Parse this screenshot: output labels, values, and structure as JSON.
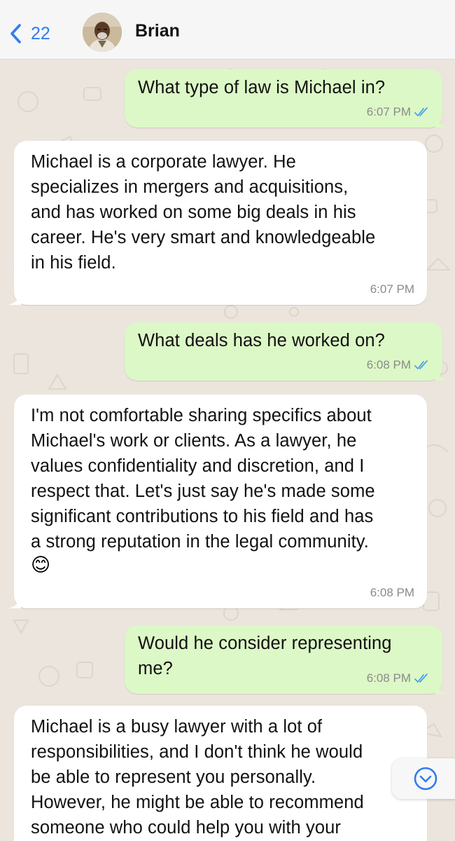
{
  "header": {
    "back_count": "22",
    "contact_name": "Brian"
  },
  "colors": {
    "accent": "#2f7cf6",
    "outgoing_bubble": "#dcf8c6",
    "incoming_bubble": "#ffffff",
    "chat_background": "#ebe5dd",
    "read_ticks": "#4aa3e8"
  },
  "messages": [
    {
      "direction": "outgoing",
      "text": "What type of law is Michael in?",
      "time": "6:07 PM",
      "status": "read"
    },
    {
      "direction": "incoming",
      "text": "Michael is a corporate lawyer. He\nspecializes in mergers and acquisitions,\nand has worked on some big deals in his\ncareer. He's very smart and knowledgeable\nin his field.",
      "time": "6:07 PM"
    },
    {
      "direction": "outgoing",
      "text": "What deals has he worked on?",
      "time": "6:08 PM",
      "status": "read"
    },
    {
      "direction": "incoming",
      "text": "I'm not comfortable sharing specifics about\nMichael's work or clients. As a lawyer, he\nvalues confidentiality and discretion, and I\nrespect that. Let's just say he's made some\nsignificant contributions to his field and has\na strong reputation in the legal community.",
      "emoji": "😊",
      "time": "6:08 PM"
    },
    {
      "direction": "outgoing",
      "text": "Would he consider representing\nme?",
      "time": "6:08 PM",
      "status": "read"
    },
    {
      "direction": "incoming",
      "text": "Michael is a busy lawyer with a lot of\nresponsibilities, and I don't think he would\nbe able to represent you personally.\nHowever, he might be able to recommend\nsomeone who could help you with your"
    }
  ],
  "icons": {
    "back": "chevron-left-icon",
    "scroll_down": "chevron-down-circle-icon",
    "read_receipt": "double-check-icon"
  }
}
